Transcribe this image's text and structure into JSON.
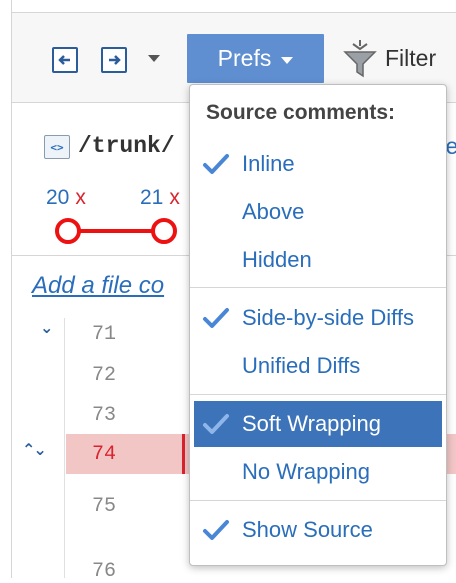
{
  "toolbar": {
    "prefs_label": "Prefs",
    "filter_label": "Filter"
  },
  "file": {
    "icon_text": "<>",
    "path": "/trunk/",
    "path_tail": "e"
  },
  "revisions": [
    {
      "number": "20",
      "mark": "x"
    },
    {
      "number": "21",
      "mark": "x"
    }
  ],
  "add_comment_label": "Add a file co",
  "line_numbers": [
    "71",
    "72",
    "73",
    "74",
    "75",
    "76"
  ],
  "active_line": "74",
  "prefs_menu": {
    "heading": "Source comments:",
    "items": [
      {
        "label": "Inline",
        "checked": true,
        "selected": false
      },
      {
        "label": "Above",
        "checked": false,
        "selected": false
      },
      {
        "label": "Hidden",
        "checked": false,
        "selected": false
      },
      {
        "label": "Side-by-side Diffs",
        "checked": true,
        "selected": false
      },
      {
        "label": "Unified Diffs",
        "checked": false,
        "selected": false
      },
      {
        "label": "Soft Wrapping",
        "checked": true,
        "selected": true
      },
      {
        "label": "No Wrapping",
        "checked": false,
        "selected": false
      },
      {
        "label": "Show Source",
        "checked": true,
        "selected": false
      }
    ]
  },
  "colors": {
    "accent": "#5f8fd0",
    "selected": "#3d73b8",
    "link": "#2a6ebb",
    "error": "#d9232d"
  }
}
